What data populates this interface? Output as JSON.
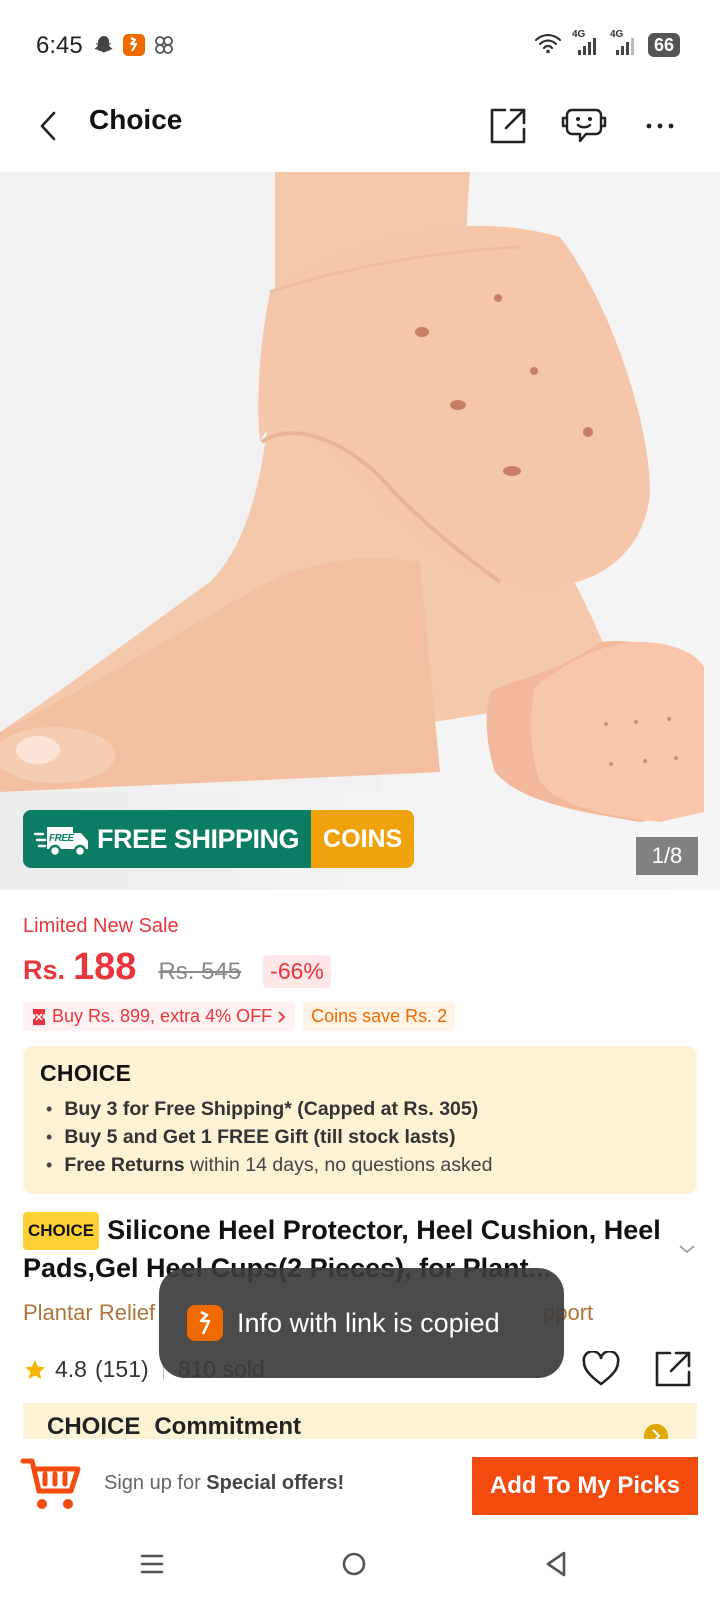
{
  "status_bar": {
    "time": "6:45",
    "battery": "66",
    "network_label": "4G"
  },
  "header": {
    "title": "Choice"
  },
  "gallery": {
    "counter": "1/8",
    "shipping_badge": "FREE SHIPPING",
    "shipping_badge_icon_text": "FREE",
    "coins_badge": "COINS"
  },
  "price": {
    "sale_label": "Limited New Sale",
    "currency": "Rs.",
    "current": "188",
    "original": "Rs. 545",
    "discount": "-66%"
  },
  "promos": {
    "extra_off": "Buy Rs. 899, extra 4% OFF",
    "coins": "Coins save Rs. 2"
  },
  "choice_box": {
    "logo": "CHOICE",
    "items": [
      {
        "bold": "Buy 3 for  Free Shipping* (Capped at Rs. 305)",
        "rest": ""
      },
      {
        "bold": "Buy 5 and Get 1 FREE Gift (till stock lasts)",
        "rest": ""
      },
      {
        "bold": "Free Returns",
        "rest": " within 14 days, no questions asked"
      }
    ]
  },
  "product": {
    "badge": "CHOICE",
    "title": "Silicone Heel Protector, Heel Cushion, Heel Pads,Gel Heel Cups(2 Pieces), for Plant...",
    "subtitle_start": "Plantar Relief",
    "subtitle_end": "pport",
    "rating": "4.8",
    "reviews": "(151)",
    "sold": "810 sold"
  },
  "commitment": {
    "label": "Commitment"
  },
  "toast": {
    "text": "Info with link is copied"
  },
  "bottom_bar": {
    "signup_prefix": "Sign up for ",
    "signup_bold": "Special offers!",
    "cta": "Add To My Picks"
  },
  "colors": {
    "accent": "#f34a0e",
    "price_red": "#e8363c",
    "shipping_green": "#0a7d64",
    "coins_orange": "#f0a20c",
    "choice_bg": "#fdf2d4"
  }
}
